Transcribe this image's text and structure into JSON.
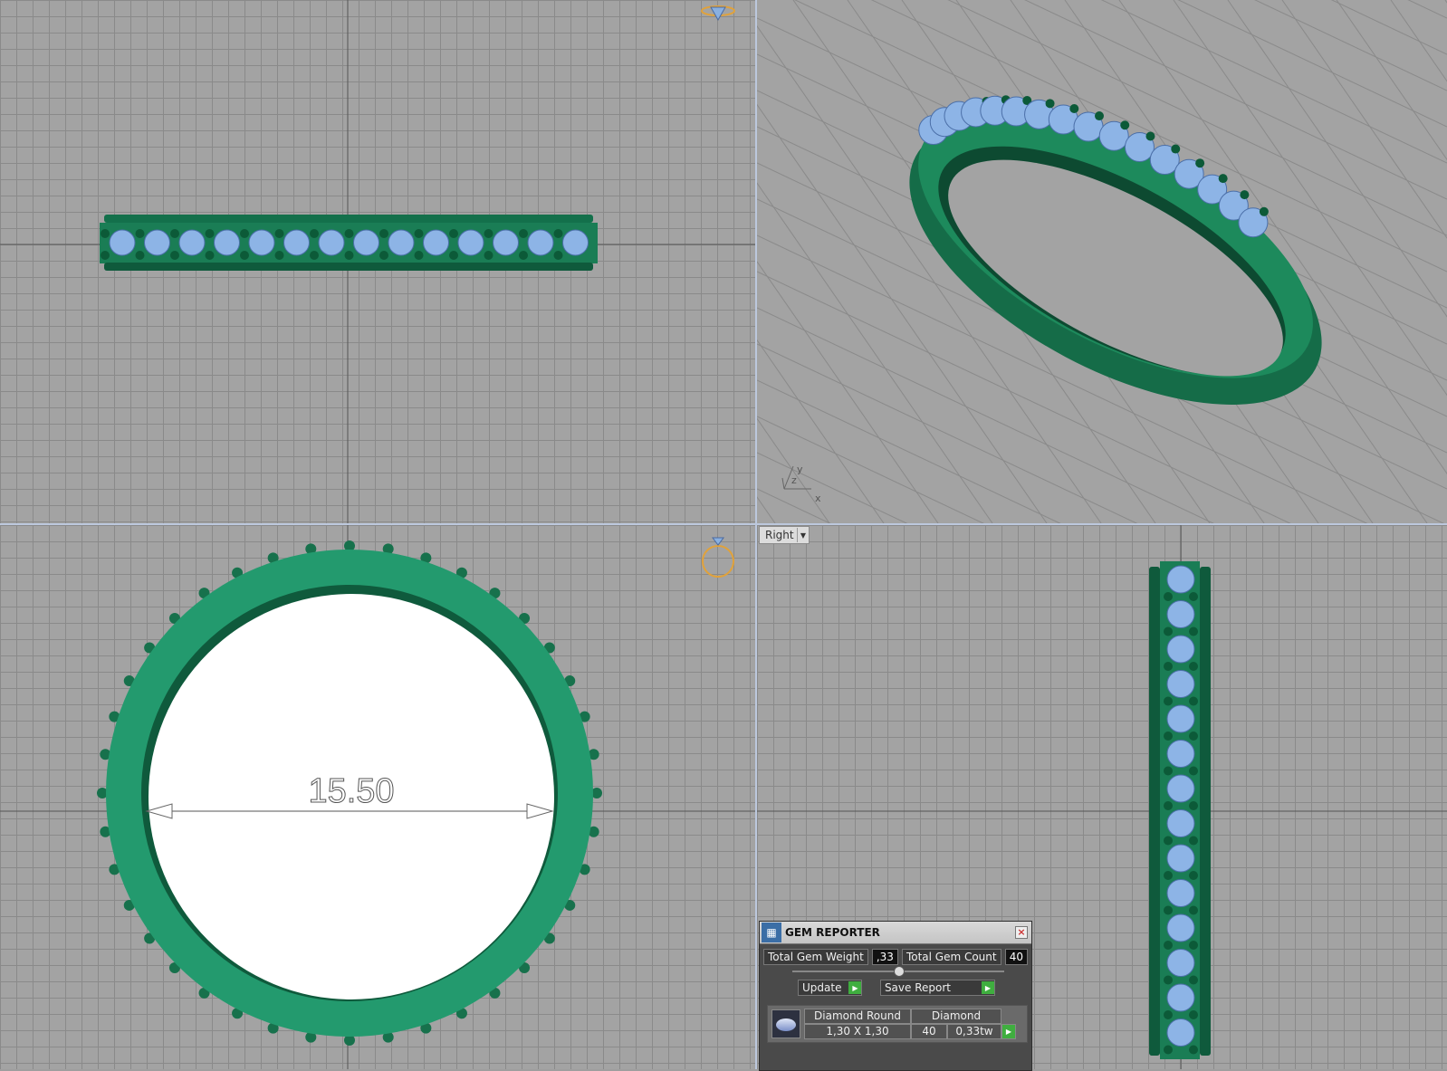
{
  "viewports": {
    "bottom_left": {
      "dimension_label": "15.50"
    },
    "bottom_right": {
      "view_selector": "Right"
    },
    "perspective": {
      "axis_labels": [
        "y",
        "z",
        "x"
      ]
    }
  },
  "gem_reporter": {
    "title": "GEM REPORTER",
    "total_weight_label": "Total Gem Weight",
    "total_weight_value": ",33",
    "total_count_label": "Total Gem Count",
    "total_count_value": "40",
    "update_label": "Update",
    "save_report_label": "Save Report",
    "table": {
      "header": [
        "Diamond Round",
        "Diamond"
      ],
      "row": [
        "1,30 X 1,30",
        "40",
        "0,33tw"
      ]
    }
  },
  "colors": {
    "metal": "#1f8f62",
    "gem": "#8db4e6",
    "grid": "#8a8a8a",
    "background": "#a3a3a3"
  }
}
